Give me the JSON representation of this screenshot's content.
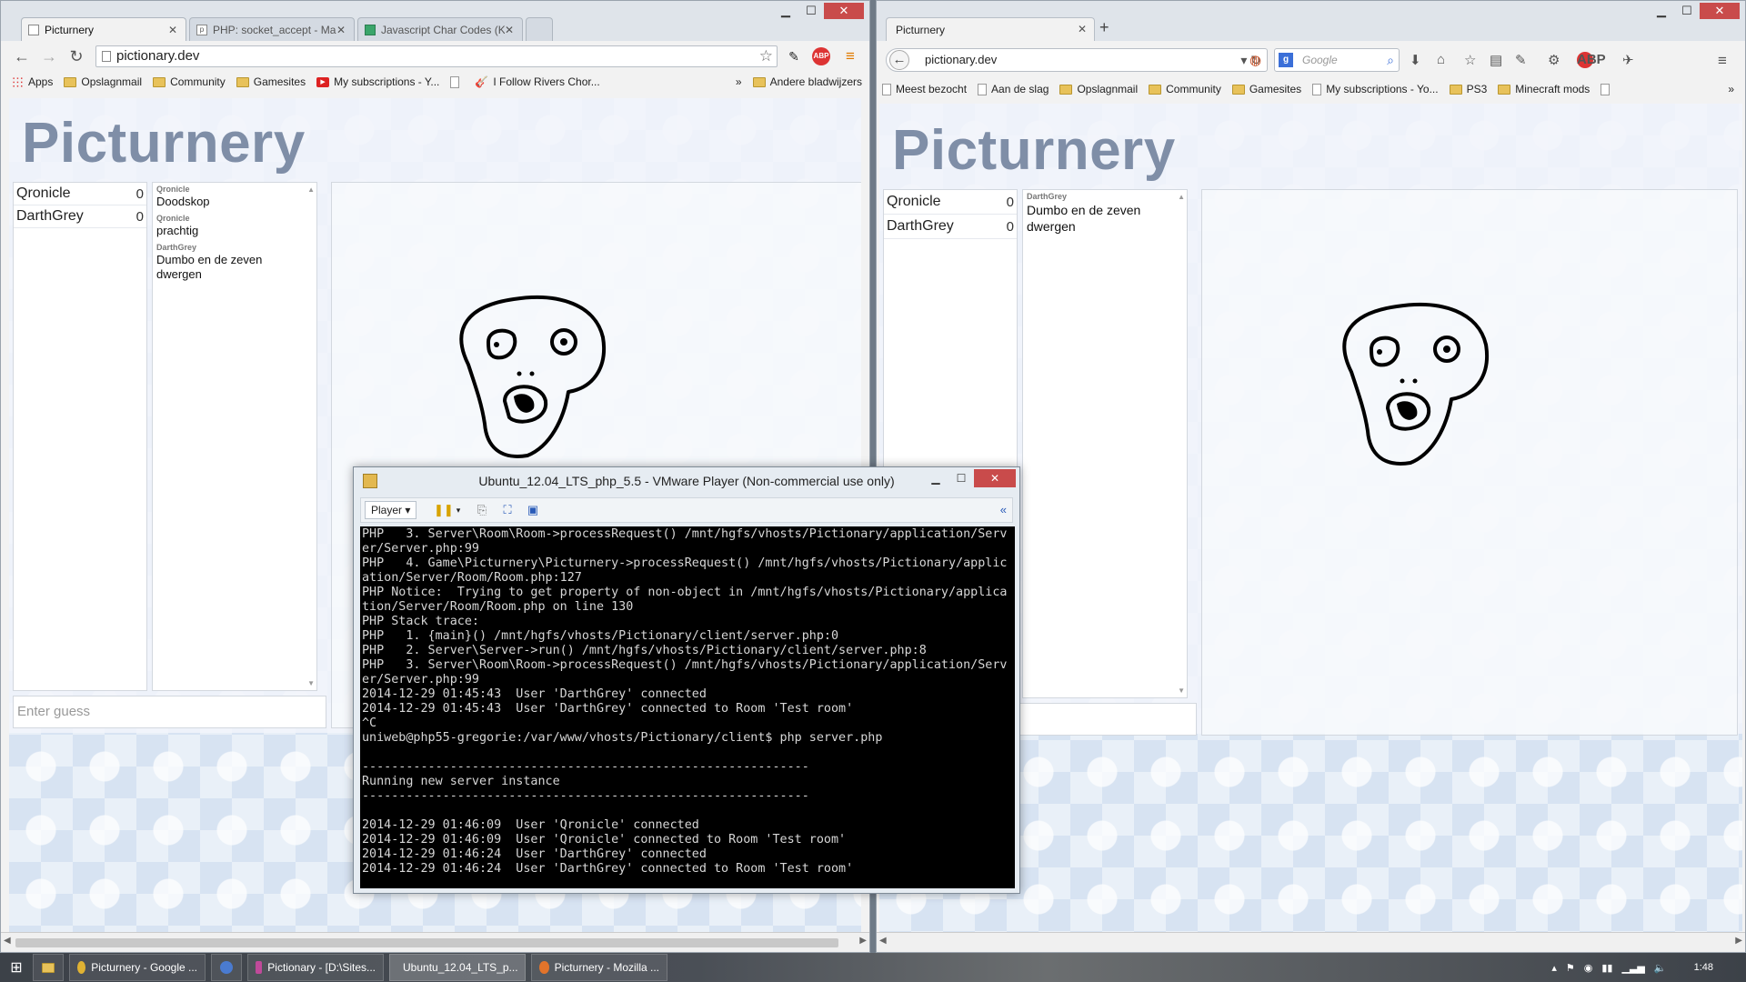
{
  "chrome": {
    "tabs": [
      {
        "label": "Picturnery",
        "icon": "page-icon",
        "active": true
      },
      {
        "label": "PHP: socket_accept - Man",
        "icon": "php-icon",
        "active": false
      },
      {
        "label": "Javascript Char Codes (Ke",
        "icon": "site-icon",
        "active": false
      }
    ],
    "url": "pictionary.dev",
    "bookmarks": [
      {
        "label": "Apps",
        "icon": "apps-icon"
      },
      {
        "label": "Opslagnmail",
        "icon": "folder-icon"
      },
      {
        "label": "Community",
        "icon": "folder-icon"
      },
      {
        "label": "Gamesites",
        "icon": "folder-icon"
      },
      {
        "label": "My subscriptions - Y...",
        "icon": "youtube-icon"
      },
      {
        "label": "",
        "icon": "page-icon"
      },
      {
        "label": "I Follow Rivers Chor...",
        "icon": "guitar-icon"
      }
    ],
    "bookmarks_overflow": "»",
    "other_bookmarks": "Andere bladwijzers"
  },
  "firefox": {
    "tab_label": "Picturnery",
    "url": "pictionary.dev",
    "search_placeholder": "Google",
    "bookmarks": [
      {
        "label": "Meest bezocht",
        "icon": "page-icon"
      },
      {
        "label": "Aan de slag",
        "icon": "page-icon"
      },
      {
        "label": "Opslagnmail",
        "icon": "folder-icon"
      },
      {
        "label": "Community",
        "icon": "folder-icon"
      },
      {
        "label": "Gamesites",
        "icon": "folder-icon"
      },
      {
        "label": "My subscriptions - Yo...",
        "icon": "page-icon"
      },
      {
        "label": "PS3",
        "icon": "folder-icon"
      },
      {
        "label": "Minecraft mods",
        "icon": "folder-icon"
      }
    ],
    "bookmarks_overflow": "»"
  },
  "game_left": {
    "logo": "Picturnery",
    "players": [
      {
        "name": "Qronicle",
        "score": "0"
      },
      {
        "name": "DarthGrey",
        "score": "0"
      }
    ],
    "messages": [
      {
        "author": "Qronicle",
        "text": "Doodskop"
      },
      {
        "author": "Qronicle",
        "text": "prachtig"
      },
      {
        "author": "DarthGrey",
        "text": "Dumbo en de zeven dwergen"
      }
    ],
    "guess_placeholder": "Enter guess"
  },
  "game_right": {
    "logo": "Picturnery",
    "players": [
      {
        "name": "Qronicle",
        "score": "0"
      },
      {
        "name": "DarthGrey",
        "score": "0"
      }
    ],
    "messages": [
      {
        "author": "DarthGrey",
        "text": "Dumbo en de zeven dwergen"
      }
    ]
  },
  "vmware": {
    "title": "Ubuntu_12.04_LTS_php_5.5 - VMware Player (Non-commercial use only)",
    "player_menu": "Player",
    "terminal_lines": [
      "PHP   3. Server\\Room\\Room->processRequest() /mnt/hgfs/vhosts/Pictionary/application/Server/Server.php:99",
      "PHP   4. Game\\Picturnery\\Picturnery->processRequest() /mnt/hgfs/vhosts/Pictionary/application/Server/Room/Room.php:127",
      "PHP Notice:  Trying to get property of non-object in /mnt/hgfs/vhosts/Pictionary/application/Server/Room/Room.php on line 130",
      "PHP Stack trace:",
      "PHP   1. {main}() /mnt/hgfs/vhosts/Pictionary/client/server.php:0",
      "PHP   2. Server\\Server->run() /mnt/hgfs/vhosts/Pictionary/client/server.php:8",
      "PHP   3. Server\\Room\\Room->processRequest() /mnt/hgfs/vhosts/Pictionary/application/Server/Server.php:99",
      "2014-12-29 01:45:43  User 'DarthGrey' connected",
      "2014-12-29 01:45:43  User 'DarthGrey' connected to Room 'Test room'",
      "^C",
      "uniweb@php55-gregorie:/var/www/vhosts/Pictionary/client$ php server.php",
      "",
      "-------------------------------------------------------------",
      "Running new server instance",
      "-------------------------------------------------------------",
      "",
      "2014-12-29 01:46:09  User 'Qronicle' connected",
      "2014-12-29 01:46:09  User 'Qronicle' connected to Room 'Test room'",
      "2014-12-29 01:46:24  User 'DarthGrey' connected",
      "2014-12-29 01:46:24  User 'DarthGrey' connected to Room 'Test room'",
      "_"
    ]
  },
  "taskbar": {
    "items": [
      {
        "label": "Picturnery - Google ...",
        "icon": "chrome-icon",
        "color": "#e0b233"
      },
      {
        "label": "",
        "icon": "app-icon",
        "color": "#4a7bd0"
      },
      {
        "label": "Pictionary - [D:\\Sites...",
        "icon": "phpstorm-icon",
        "color": "#c04a9a"
      },
      {
        "label": "Ubuntu_12.04_LTS_p...",
        "icon": "vmware-icon",
        "color": "#e3b84f"
      },
      {
        "label": "Picturnery - Mozilla ...",
        "icon": "firefox-icon",
        "color": "#e2742b"
      }
    ],
    "clock": "1:48"
  }
}
